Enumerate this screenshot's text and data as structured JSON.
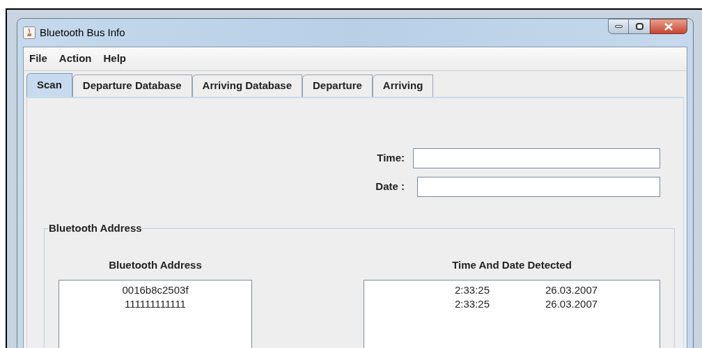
{
  "window": {
    "title": "Bluetooth Bus Info"
  },
  "menu": [
    "File",
    "Action",
    "Help"
  ],
  "tabs": [
    {
      "label": "Scan",
      "selected": true
    },
    {
      "label": "Departure Database",
      "selected": false
    },
    {
      "label": "Arriving Database",
      "selected": false
    },
    {
      "label": "Departure",
      "selected": false
    },
    {
      "label": "Arriving",
      "selected": false
    }
  ],
  "fields": [
    {
      "label": "Time:"
    },
    {
      "label": "Date :"
    }
  ],
  "group": {
    "title": "Bluetooth Address",
    "address_list": {
      "heading": "Bluetooth Address",
      "rows": [
        "0016b8c2503f",
        "111111111111"
      ]
    },
    "detected_list": {
      "heading": "Time And Date Detected",
      "rows": [
        {
          "time": "2:33:25",
          "date": "26.03.2007"
        },
        {
          "time": "2:33:25",
          "date": "26.03.2007"
        }
      ]
    }
  }
}
